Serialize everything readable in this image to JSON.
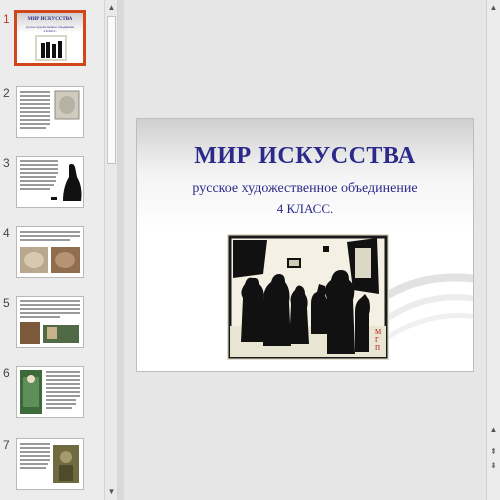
{
  "thumbnails": [
    {
      "number": "1",
      "title": "МИР ИСКУССТВА",
      "subtitle": "русское художественное объединение",
      "grade": "4 КЛАСС.",
      "active": true
    },
    {
      "number": "2",
      "active": false
    },
    {
      "number": "3",
      "active": false
    },
    {
      "number": "4",
      "active": false
    },
    {
      "number": "5",
      "active": false
    },
    {
      "number": "6",
      "active": false
    },
    {
      "number": "7",
      "active": false
    }
  ],
  "slide": {
    "title": "МИР ИСКУССТВА",
    "subtitle": "русское художественное объединение",
    "grade": "4 КЛАСС.",
    "picture_monogram": "М\nГ\nП",
    "picture_name": "silhouette-illustration"
  },
  "colors": {
    "title_color": "#2b2a8a",
    "active_thumb_border": "#d2461c",
    "active_thumb_number": "#c0392b"
  },
  "scroll": {
    "up_arrow": "▲",
    "down_arrow": "▼",
    "prev_slide": "⇞",
    "next_slide": "⇟"
  }
}
